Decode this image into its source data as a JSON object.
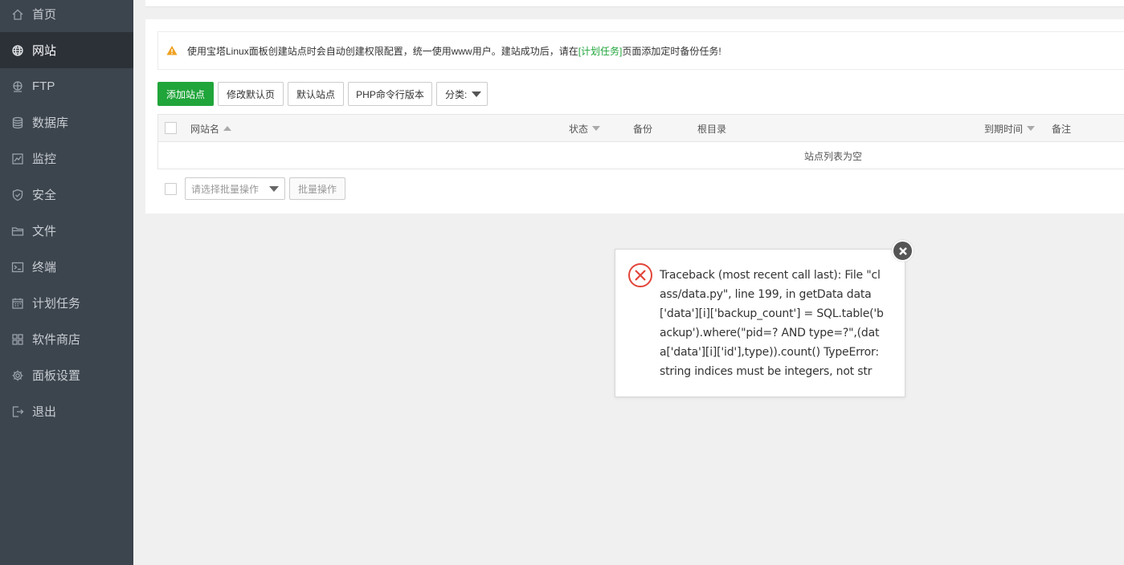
{
  "sidebar": {
    "items": [
      {
        "label": "首页",
        "icon": "home-icon"
      },
      {
        "label": "网站",
        "icon": "globe-icon"
      },
      {
        "label": "FTP",
        "icon": "ftp-icon"
      },
      {
        "label": "数据库",
        "icon": "database-icon"
      },
      {
        "label": "监控",
        "icon": "monitor-icon"
      },
      {
        "label": "安全",
        "icon": "shield-icon"
      },
      {
        "label": "文件",
        "icon": "folder-icon"
      },
      {
        "label": "终端",
        "icon": "terminal-icon"
      },
      {
        "label": "计划任务",
        "icon": "calendar-icon"
      },
      {
        "label": "软件商店",
        "icon": "grid-icon"
      },
      {
        "label": "面板设置",
        "icon": "gear-icon"
      },
      {
        "label": "退出",
        "icon": "logout-icon"
      }
    ],
    "active": "网站"
  },
  "notice": {
    "prefix": "使用宝塔Linux面板创建站点时会自动创建权限配置，统一使用www用户。建站成功后，请在",
    "link": "[计划任务]",
    "suffix": "页面添加定时备份任务!"
  },
  "toolbar": {
    "add_site": "添加站点",
    "edit_default_page": "修改默认页",
    "default_site": "默认站点",
    "php_cli_version": "PHP命令行版本",
    "category": "分类:"
  },
  "table": {
    "columns": [
      "网站名",
      "状态",
      "备份",
      "根目录",
      "到期时间",
      "备注"
    ],
    "empty_text": "站点列表为空"
  },
  "batch": {
    "select_placeholder": "请选择批量操作",
    "button": "批量操作"
  },
  "dialog": {
    "message": "Traceback (most recent call last): File \"class/data.py\", line 199, in getData data['data'][i]['backup_count'] = SQL.table('backup').where(\"pid=? AND type=?\",(data['data'][i]['id'],type)).count() TypeError: string indices must be integers, not str"
  },
  "colors": {
    "sidebar_bg": "#3c444d",
    "sidebar_active": "#2c3138",
    "brand_green": "#20a53a",
    "warning_orange": "#f0a020",
    "error_red": "#e2463a"
  }
}
